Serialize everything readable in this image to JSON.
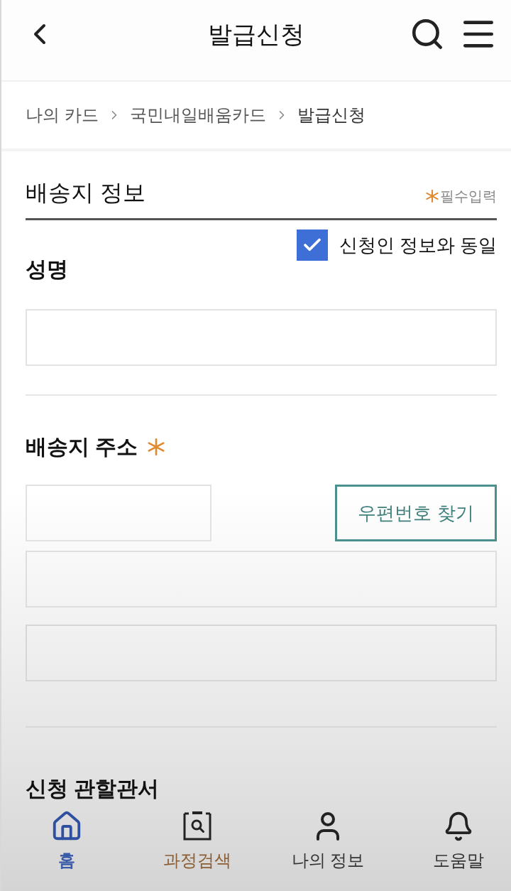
{
  "header": {
    "title": "발급신청"
  },
  "breadcrumb": [
    {
      "label": "나의 카드"
    },
    {
      "label": "국민내일배움카드"
    },
    {
      "label": "발급신청"
    }
  ],
  "section": {
    "title": "배송지 정보",
    "required_note": "필수입력"
  },
  "same_as_applicant": {
    "label": "신청인 정보와 동일",
    "checked": true
  },
  "fields": [
    {
      "kind": "text",
      "label": "성명",
      "required": false
    },
    {
      "kind": "address",
      "label": "배송지 주소",
      "required": true,
      "button": "우편번호 찾기"
    }
  ],
  "next_field": {
    "label": "신청 관할관서"
  },
  "bottom_nav": [
    {
      "kind": "home",
      "label": "홈",
      "selected": true,
      "color": "#3a5ba8"
    },
    {
      "kind": "course-search",
      "label": "과정검색",
      "selected": false,
      "color": "#8a5d32"
    },
    {
      "kind": "profile",
      "label": "나의 정보",
      "selected": false,
      "color": "#333333"
    },
    {
      "kind": "help",
      "label": "도움말",
      "selected": false,
      "color": "#333333"
    }
  ]
}
